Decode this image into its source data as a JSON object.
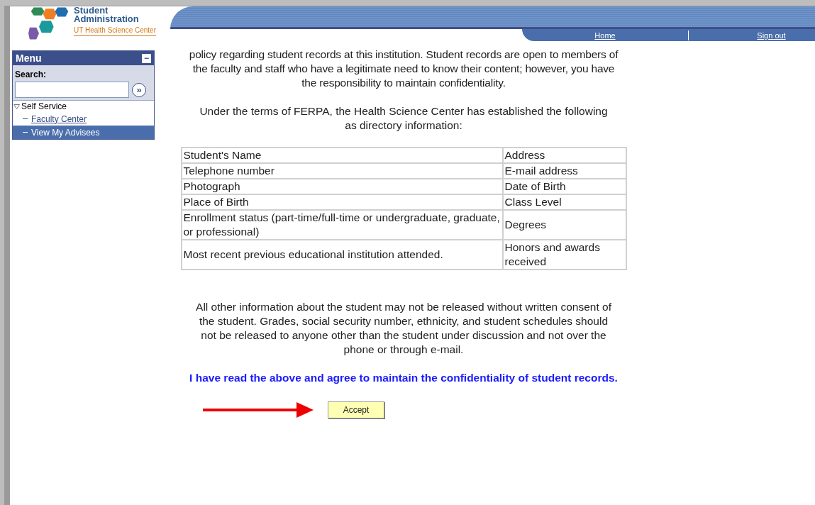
{
  "logo": {
    "title": "Student Administration",
    "subtitle": "UT Health Science Center"
  },
  "nav": [
    {
      "label": "Home"
    },
    {
      "label": "Sign out"
    }
  ],
  "menu": {
    "title": "Menu",
    "collapse": "−",
    "search_label": "Search:",
    "search_button": "»",
    "items": [
      {
        "label": "Self Service",
        "expanded": true,
        "children": [
          {
            "label": "Faculty Center",
            "selected": false
          },
          {
            "label": "View My Advisees",
            "selected": true
          }
        ]
      }
    ]
  },
  "intro": "policy regarding student records at this institution. Student records are open to members of the faculty and staff who have a legitimate need to know their content; however, you have the responsibility to maintain confidentiality.",
  "ferpa": "Under the terms of FERPA, the Health Science Center has established the following as directory information:",
  "table": {
    "rows": [
      [
        "Student's Name",
        "Address"
      ],
      [
        "Telephone number",
        "E-mail address"
      ],
      [
        "Photograph",
        "Date of Birth"
      ],
      [
        "Place of Birth",
        "Class Level"
      ],
      [
        "Enrollment status (part-time/full-time or undergraduate, graduate, or professional)",
        "Degrees"
      ],
      [
        "Most recent previous educational institution attended.",
        "Honors and awards received"
      ]
    ]
  },
  "notice": "All other information about the student may not be released without written consent of the student. Grades, social security number, ethnicity, and student schedules should not be released to anyone other than the student under discussion and not over the phone or through e-mail.",
  "agreement": "I have read the above and agree to maintain the confidentiality of student records.",
  "accept_button": "Accept"
}
